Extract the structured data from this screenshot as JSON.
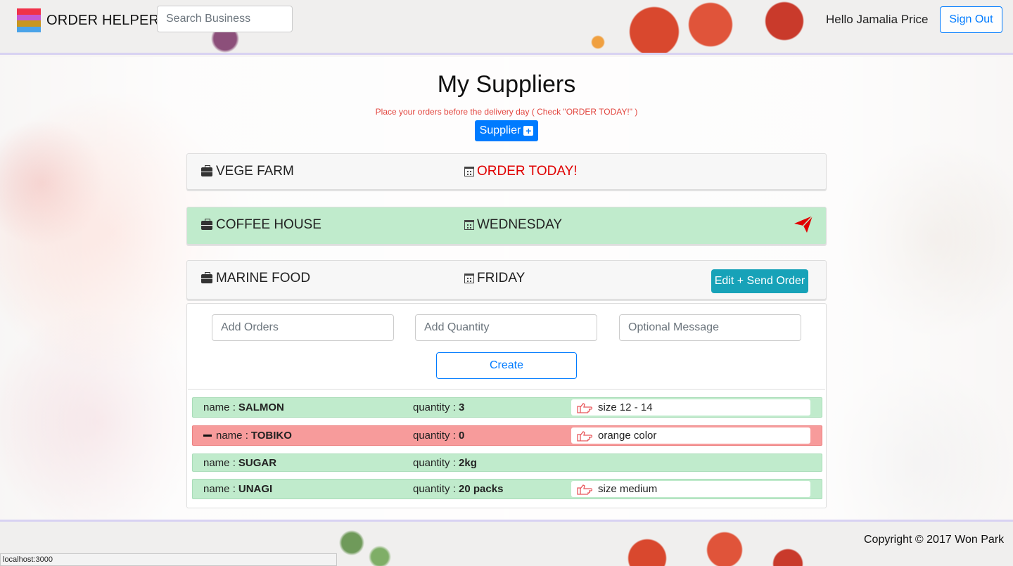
{
  "header": {
    "brand": "ORDER HELPER",
    "logo_colors": [
      "#f0324a",
      "#c558d4",
      "#c8961e",
      "#4aa3e8"
    ],
    "search_placeholder": "Search Business",
    "greeting": "Hello Jamalia Price",
    "signout_label": "Sign Out"
  },
  "main": {
    "title": "My Suppliers",
    "subtitle": "Place your orders before the delivery day ( Check \"ORDER TODAY!\" )",
    "add_supplier_label": "Supplier"
  },
  "suppliers": [
    {
      "name": "VEGE FARM",
      "day": "ORDER TODAY!",
      "status": "today"
    },
    {
      "name": "COFFEE HOUSE",
      "day": "WEDNESDAY",
      "status": "sent"
    },
    {
      "name": "MARINE FOOD",
      "day": "FRIDAY",
      "action_label": "Edit + Send Order"
    }
  ],
  "order_form": {
    "orders_placeholder": "Add Orders",
    "quantity_placeholder": "Add Quantity",
    "message_placeholder": "Optional Message",
    "create_label": "Create"
  },
  "orders": [
    {
      "name_label": "name :",
      "name": "SALMON",
      "qty_label": "quantity :",
      "quantity": "3",
      "message": "size 12 - 14",
      "status": "ok"
    },
    {
      "name_label": "name :",
      "name": "TOBIKO",
      "qty_label": "quantity :",
      "quantity": "0",
      "message": "orange color",
      "status": "removed"
    },
    {
      "name_label": "name :",
      "name": "SUGAR",
      "qty_label": "quantity :",
      "quantity": "2kg",
      "message": "",
      "status": "ok"
    },
    {
      "name_label": "name :",
      "name": "UNAGI",
      "qty_label": "quantity :",
      "quantity": "20 packs",
      "message": "size medium",
      "status": "ok"
    }
  ],
  "footer": {
    "copyright": "Copyright © 2017 Won Park"
  },
  "status_bar": {
    "url": "localhost:3000"
  },
  "colors": {
    "primary": "#007bff",
    "info": "#17a2b8",
    "today": "#e00000",
    "green_row": "#c0ebcc",
    "red_row": "#f79b9b"
  }
}
